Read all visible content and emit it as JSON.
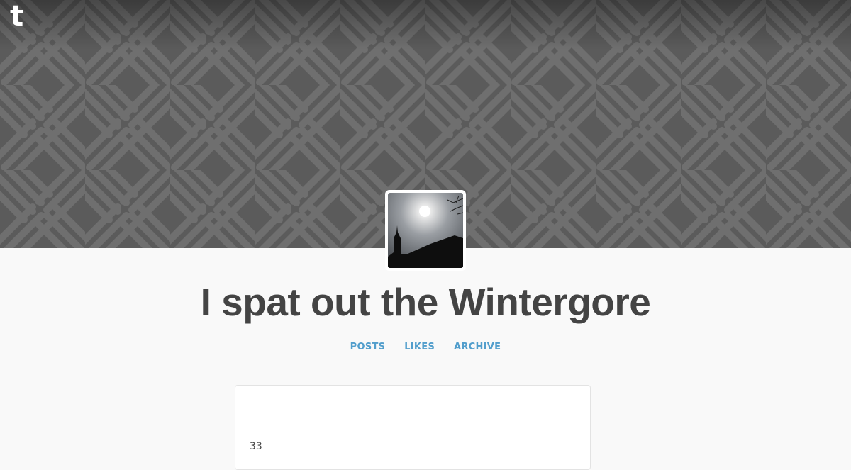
{
  "header": {
    "logo_icon": "tumblr-logo-icon",
    "logo_text": "t",
    "pattern": "basketweave-diagonal-stripes",
    "colors": {
      "background": "#5a5a5a",
      "stripe": "#6e6e6e"
    }
  },
  "avatar": {
    "icon": "church-silhouette-sun-image"
  },
  "blog": {
    "title": "I spat out the Wintergore"
  },
  "nav": {
    "posts": "POSTS",
    "likes": "LIKES",
    "archive": "ARCHIVE",
    "link_color": "#529ecc"
  },
  "post": {
    "text": "33"
  }
}
